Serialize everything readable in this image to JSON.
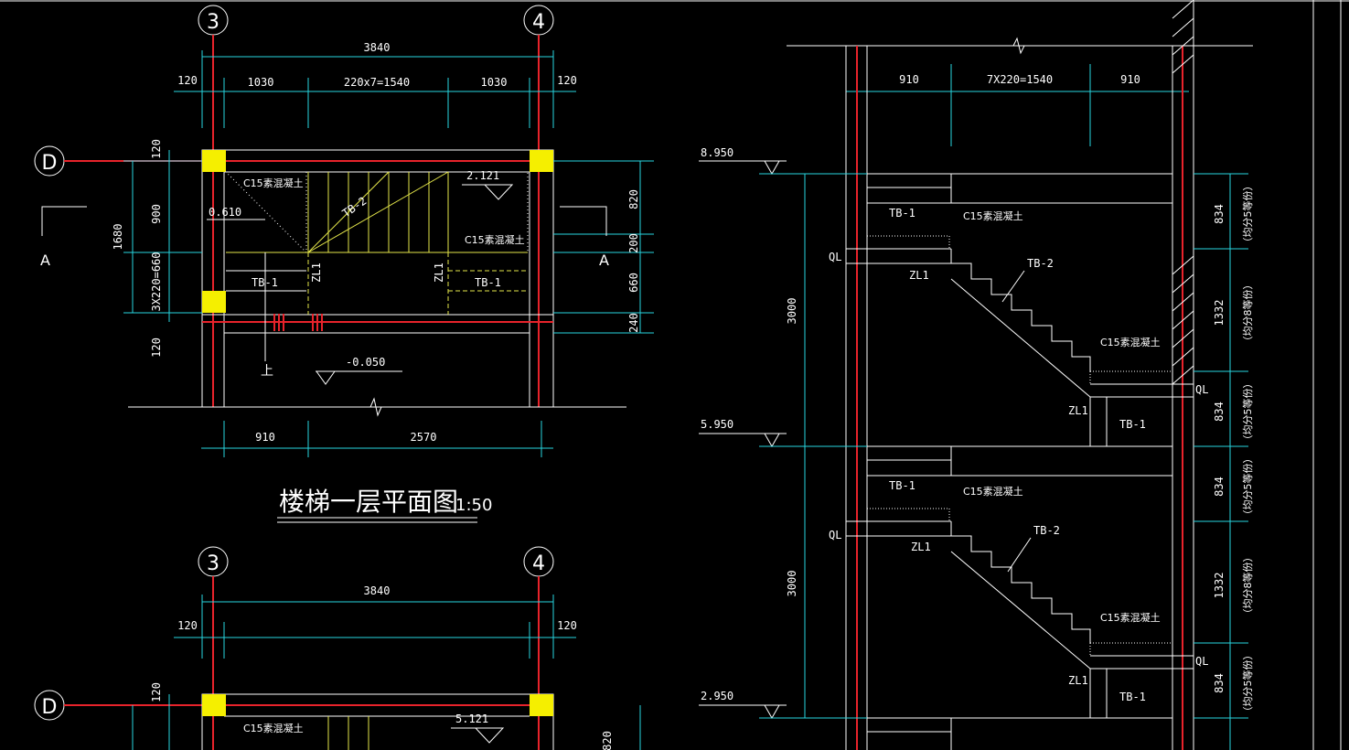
{
  "plan": {
    "axis_left": "3",
    "axis_right": "4",
    "axis_row": "D",
    "dim_total": "3840",
    "dim_left_wall": "120",
    "dim_right_wall": "120",
    "dim_seg1": "1030",
    "dim_seg2": "220x7=1540",
    "dim_seg3": "1030",
    "dim_left_v1": "120",
    "dim_left_v2": "900",
    "dim_left_v3": "1680",
    "dim_left_v4": "3X220=660",
    "dim_left_v5": "120",
    "dim_right_v1": "820",
    "dim_right_v2": "200",
    "dim_right_v3": "660",
    "dim_right_v4": "240",
    "dim_bottom1": "910",
    "dim_bottom2": "2570",
    "section_a_left": "A",
    "section_a_right": "A",
    "elev_0610": "0.610",
    "elev_2121": "2.121",
    "elev_m0050": "-0.050",
    "label_c15_a": "C15素混凝土",
    "label_c15_b": "C15素混凝土",
    "label_tb2": "TB-2",
    "label_tb1_left": "TB-1",
    "label_tb1_right": "TB-1",
    "label_zl1_left": "ZL1",
    "label_zl1_right": "ZL1",
    "label_up": "上",
    "title": "楼梯一层平面图",
    "scale": "1:50"
  },
  "plan2": {
    "axis_left": "3",
    "axis_right": "4",
    "axis_row": "D",
    "dim_total": "3840",
    "dim_left_wall": "120",
    "dim_right_wall": "120",
    "dim_left_v1": "120",
    "dim_right_v1": "820",
    "elev": "5.121",
    "label_c15": "C15素混凝土"
  },
  "section": {
    "dim_left": "910",
    "dim_mid": "7X220=1540",
    "dim_right": "910",
    "elev_top": "8.950",
    "elev_mid": "5.950",
    "elev_low": "2.950",
    "height_1": "3000",
    "height_2": "3000",
    "ql": "QL",
    "zl1": "ZL1",
    "tb1": "TB-1",
    "tb2": "TB-2",
    "c15": "C15素混凝土",
    "r_dim1": "834",
    "r_dim2": "1332",
    "r_dim3": "834",
    "r_dim4": "834",
    "r_dim5": "1332",
    "r_dim6": "834",
    "r_note5": "（均分5等份）",
    "r_note8": "（均分8等份）"
  },
  "colors": {
    "cyan": "#27d6e0",
    "red": "#e8232b",
    "yellow": "#e4e64a",
    "column": "#f5ef00",
    "white": "#ffffff"
  }
}
